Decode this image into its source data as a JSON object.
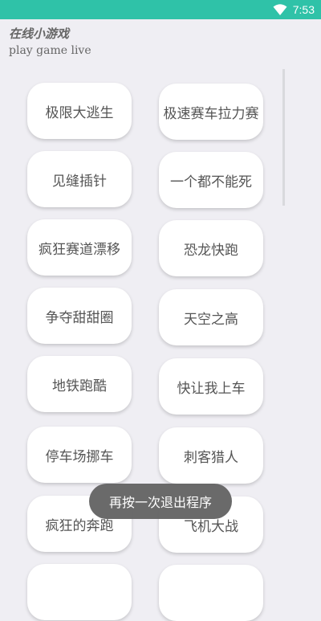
{
  "status_bar": {
    "time": "7:53"
  },
  "header": {
    "title": "在线小游戏",
    "subtitle": "play game live"
  },
  "games": [
    "极限大逃生",
    "极速赛车拉力赛",
    "见缝插针",
    "一个都不能死",
    "疯狂赛道漂移",
    "恐龙快跑",
    "争夺甜甜圈",
    "天空之高",
    "地铁跑酷",
    "快让我上车",
    "停车场挪车",
    "刺客猎人",
    "疯狂的奔跑",
    "飞机大战"
  ],
  "toast": {
    "message": "再按一次退出程序"
  },
  "colors": {
    "status_bar": "#2fc2a8",
    "background": "#efeef3",
    "card": "#ffffff",
    "text": "#555555"
  }
}
